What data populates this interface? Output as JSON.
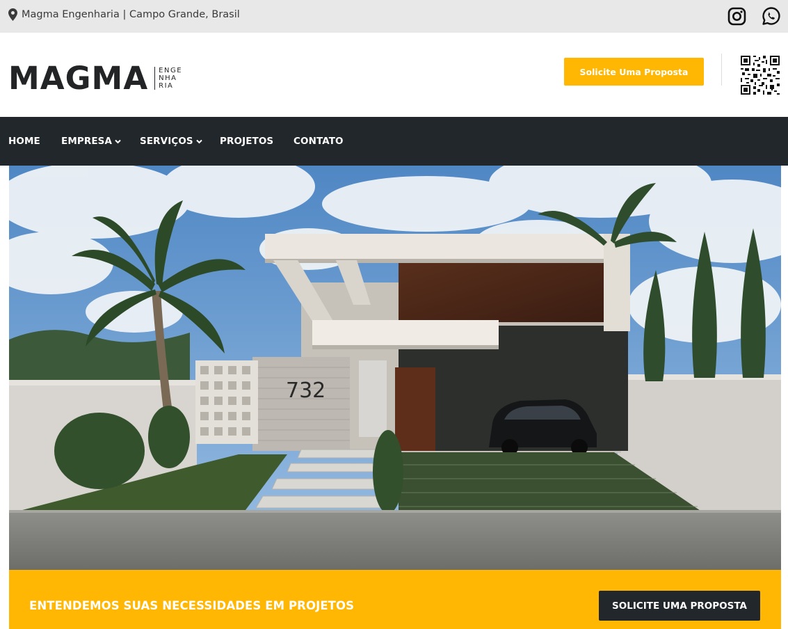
{
  "topbar": {
    "location_text": "Magma Engenharia | Campo Grande, Brasil",
    "icons": [
      "map-pin-icon",
      "instagram-icon",
      "whatsapp-icon"
    ]
  },
  "header": {
    "logo_word": "MAGMA",
    "logo_sub_lines": [
      "ENGE",
      "NHA",
      "RIA"
    ],
    "cta_label": "Solicite Uma Proposta"
  },
  "nav": {
    "items": [
      {
        "label": "HOME",
        "has_dropdown": false
      },
      {
        "label": "EMPRESA",
        "has_dropdown": true
      },
      {
        "label": "SERVIÇOS",
        "has_dropdown": true
      },
      {
        "label": "PROJETOS",
        "has_dropdown": false
      },
      {
        "label": "CONTATO",
        "has_dropdown": false
      }
    ]
  },
  "hero": {
    "house_number": "732"
  },
  "banner": {
    "text": "ENTENDEMOS SUAS NECESSIDADES EM PROJETOS",
    "cta_label": "SOLICITE UMA PROPOSTA"
  },
  "colors": {
    "accent": "#ffb703",
    "dark": "#22272b",
    "topbar_bg": "#e8e8e8"
  }
}
